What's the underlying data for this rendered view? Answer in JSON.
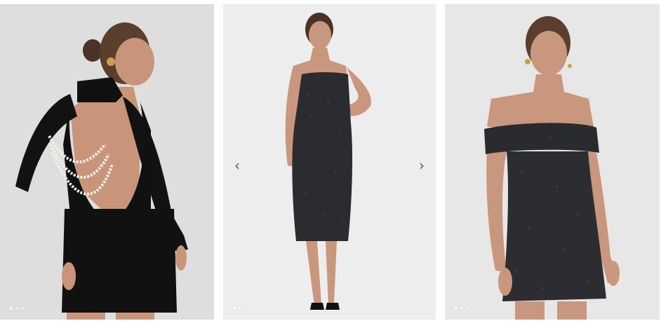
{
  "products": [
    {
      "name": "",
      "background": "#dcdcdc",
      "slides": 3,
      "active_slide": 1
    },
    {
      "name": "",
      "background": "#ececec",
      "slides": 3,
      "active_slide": 1,
      "prev_arrow": "‹",
      "next_arrow": "›"
    },
    {
      "name": "",
      "background": "#e6e6e6",
      "slides": 3,
      "active_slide": 1
    }
  ],
  "icons": {
    "prev": "chevron-left-icon",
    "next": "chevron-right-icon"
  }
}
